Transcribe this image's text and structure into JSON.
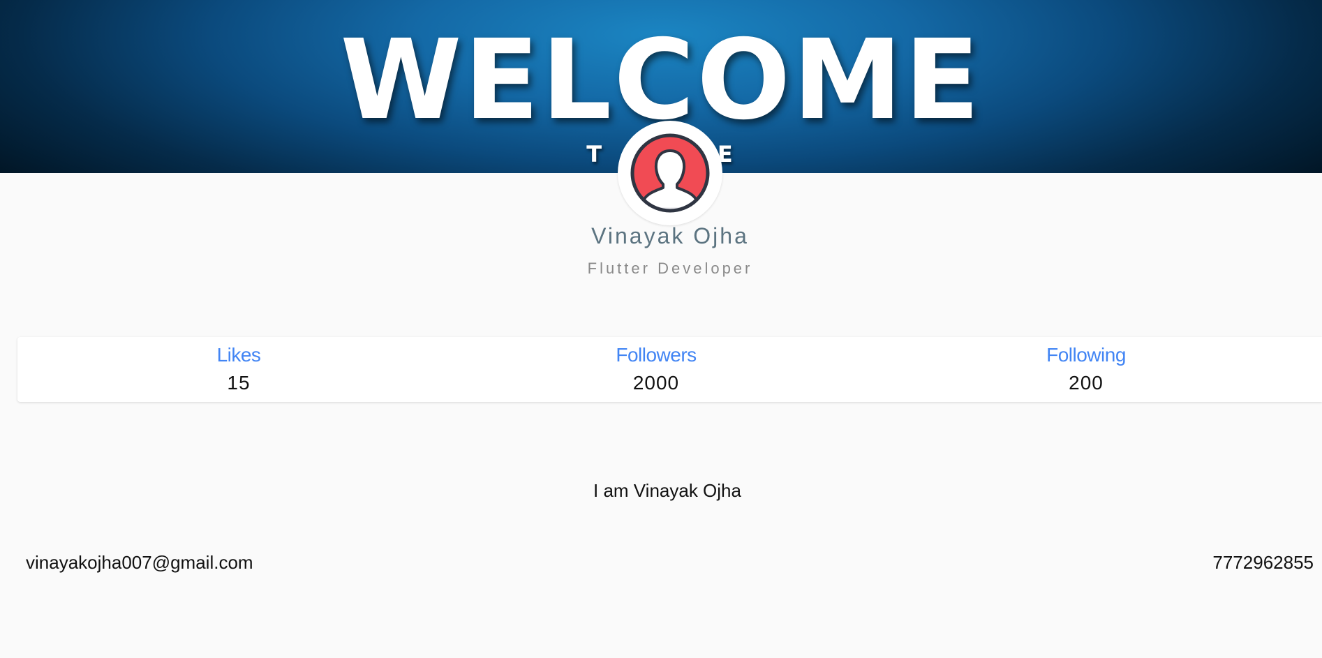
{
  "banner": {
    "title": "WELCOME",
    "subtitle_visible_fragments": [
      "T",
      "IFE"
    ]
  },
  "profile": {
    "name": "Vinayak Ojha",
    "role": "Flutter Developer",
    "avatar_icon": "user-avatar-icon",
    "avatar_color": "#f14b54"
  },
  "stats": [
    {
      "label": "Likes",
      "value": "15"
    },
    {
      "label": "Followers",
      "value": "2000"
    },
    {
      "label": "Following",
      "value": "200"
    }
  ],
  "about": {
    "bio": "I am Vinayak Ojha"
  },
  "contact": {
    "email": "vinayakojha007@gmail.com",
    "phone": "7772962855"
  },
  "colors": {
    "accent": "#4285f4",
    "name": "#5b7380",
    "background": "#fafafa",
    "banner": "#1469a6"
  }
}
